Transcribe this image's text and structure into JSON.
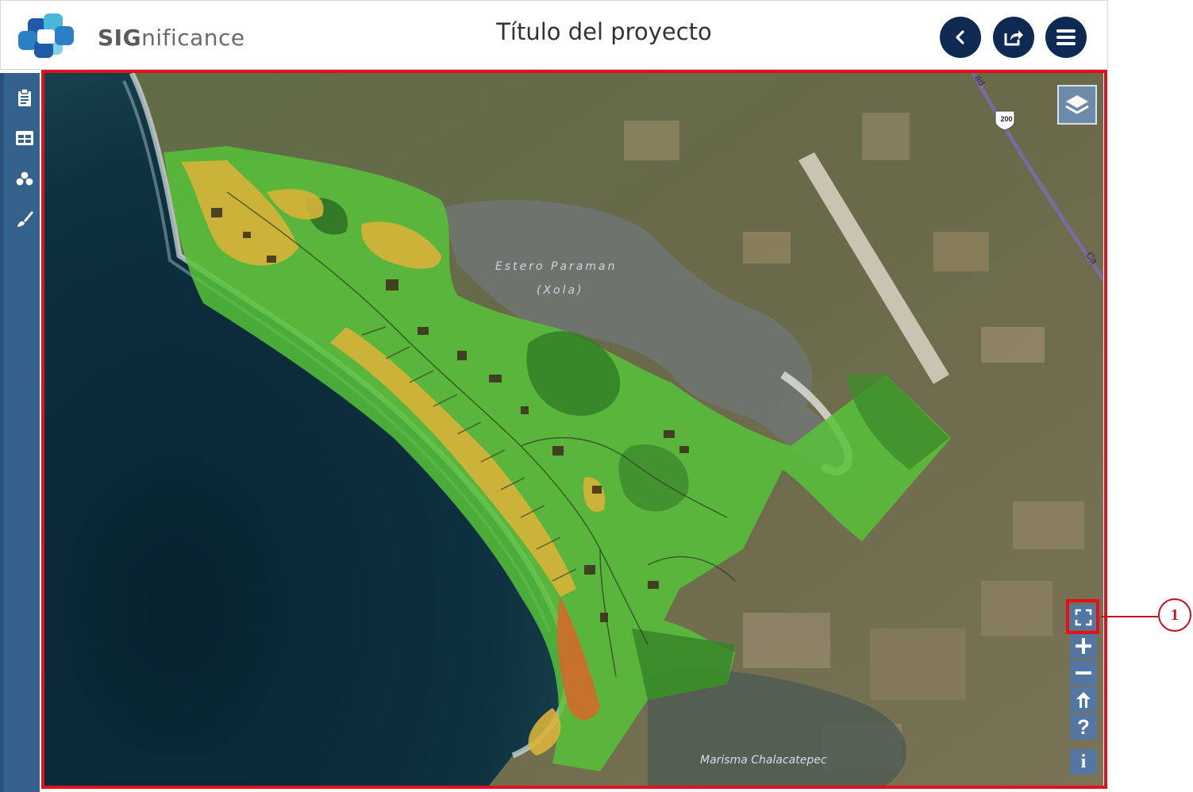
{
  "header": {
    "brand_bold": "SIG",
    "brand_rest": "nificance",
    "title": "Título del proyecto",
    "buttons": [
      "back-icon",
      "share-icon",
      "menu-icon"
    ]
  },
  "sidebar": {
    "items": [
      {
        "icon": "clipboard-icon"
      },
      {
        "icon": "table-icon"
      },
      {
        "icon": "layers-stack-icon"
      },
      {
        "icon": "paintbrush-icon"
      }
    ]
  },
  "map": {
    "labels": {
      "lagoon_line1": "Estero Paraman",
      "lagoon_line2": "(Xola)",
      "marsh": "Marisma Chalacatepec",
      "highway_shield": "200",
      "road_top": "ad",
      "road_right": "Ca"
    },
    "controls": [
      {
        "icon": "fullscreen-icon"
      },
      {
        "icon": "zoom-in-icon",
        "glyph": "+"
      },
      {
        "icon": "zoom-out-icon",
        "glyph": "−"
      },
      {
        "icon": "north-arrow-icon",
        "glyph": "↑"
      },
      {
        "icon": "help-icon",
        "glyph": "?"
      },
      {
        "icon": "info-icon",
        "glyph": "i"
      }
    ]
  },
  "annotation": {
    "number": "1"
  },
  "colors": {
    "header_button": "#0f2a52",
    "sidebar": "#35618d",
    "highlight": "#e3101d",
    "zone_green": "#5fc43a",
    "zone_yellow": "#d9b33a"
  }
}
